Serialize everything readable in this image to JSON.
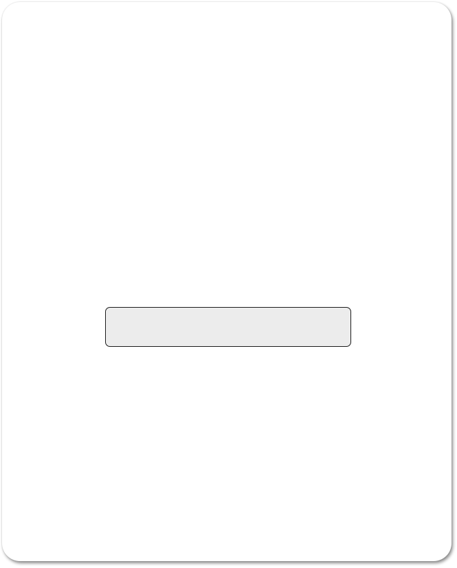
{
  "card": {},
  "input": {
    "value": "",
    "placeholder": ""
  }
}
